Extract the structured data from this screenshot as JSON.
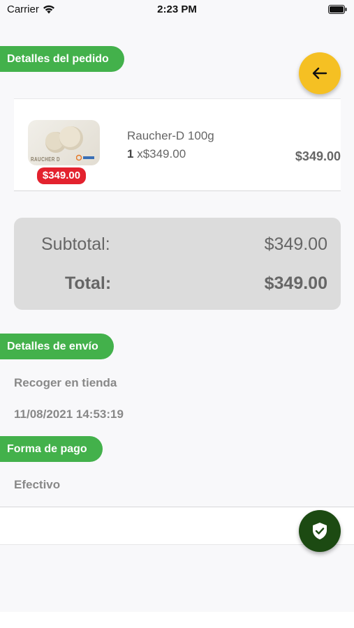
{
  "status_bar": {
    "carrier": "Carrier",
    "time": "2:23 PM"
  },
  "sections": {
    "order_details": "Detalles del pedido",
    "shipping_details": "Detalles de envío",
    "payment_method": "Forma de pago"
  },
  "product": {
    "image_brand": "RAUCHER D",
    "price_badge": "$349.00",
    "name": "Raucher-D 100g",
    "quantity": "1",
    "unit_price": " x$349.00",
    "line_total": "$349.00"
  },
  "totals": {
    "subtotal_label": "Subtotal:",
    "subtotal_value": "$349.00",
    "total_label": "Total:",
    "total_value": "$349.00"
  },
  "shipping": {
    "method": "Recoger en tienda",
    "datetime": "11/08/2021 14:53:19"
  },
  "payment": {
    "method": "Efectivo"
  },
  "colors": {
    "accent_green": "#43b14b",
    "back_button": "#f5c023",
    "confirm_button": "#1c4a12",
    "price_badge": "#e3222e"
  },
  "icons": {
    "back": "arrow-left-icon",
    "confirm": "shield-check-icon",
    "wifi": "wifi-icon",
    "battery": "battery-icon"
  }
}
